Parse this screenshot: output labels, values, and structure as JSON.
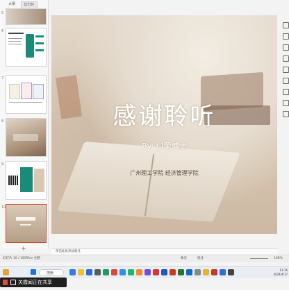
{
  "panel_tabs": [
    "大纲",
    "幻灯片"
  ],
  "thumbnails": [
    "5",
    "6",
    "7",
    "8",
    "9",
    "10"
  ],
  "slide": {
    "title": "感谢聆听",
    "author": "By: 付荣博士",
    "school": "广州理工学院 经济管理学院"
  },
  "notes": {
    "placeholder": "单击此处添加备注"
  },
  "status": {
    "slide_counter": "幻灯片 10 / 10",
    "theme": "Office 主题",
    "zoom": "108%",
    "notes_btn": "备注",
    "comments_btn": "批注"
  },
  "taskbar": {
    "search_placeholder": "搜索",
    "time": "11:16",
    "date": "2024/4/17"
  },
  "share": {
    "label": "关霞闻正在共享"
  },
  "colors": {
    "accent": "#d24726",
    "slide_title": "#ffffff",
    "teal": "#1a8a7a"
  }
}
